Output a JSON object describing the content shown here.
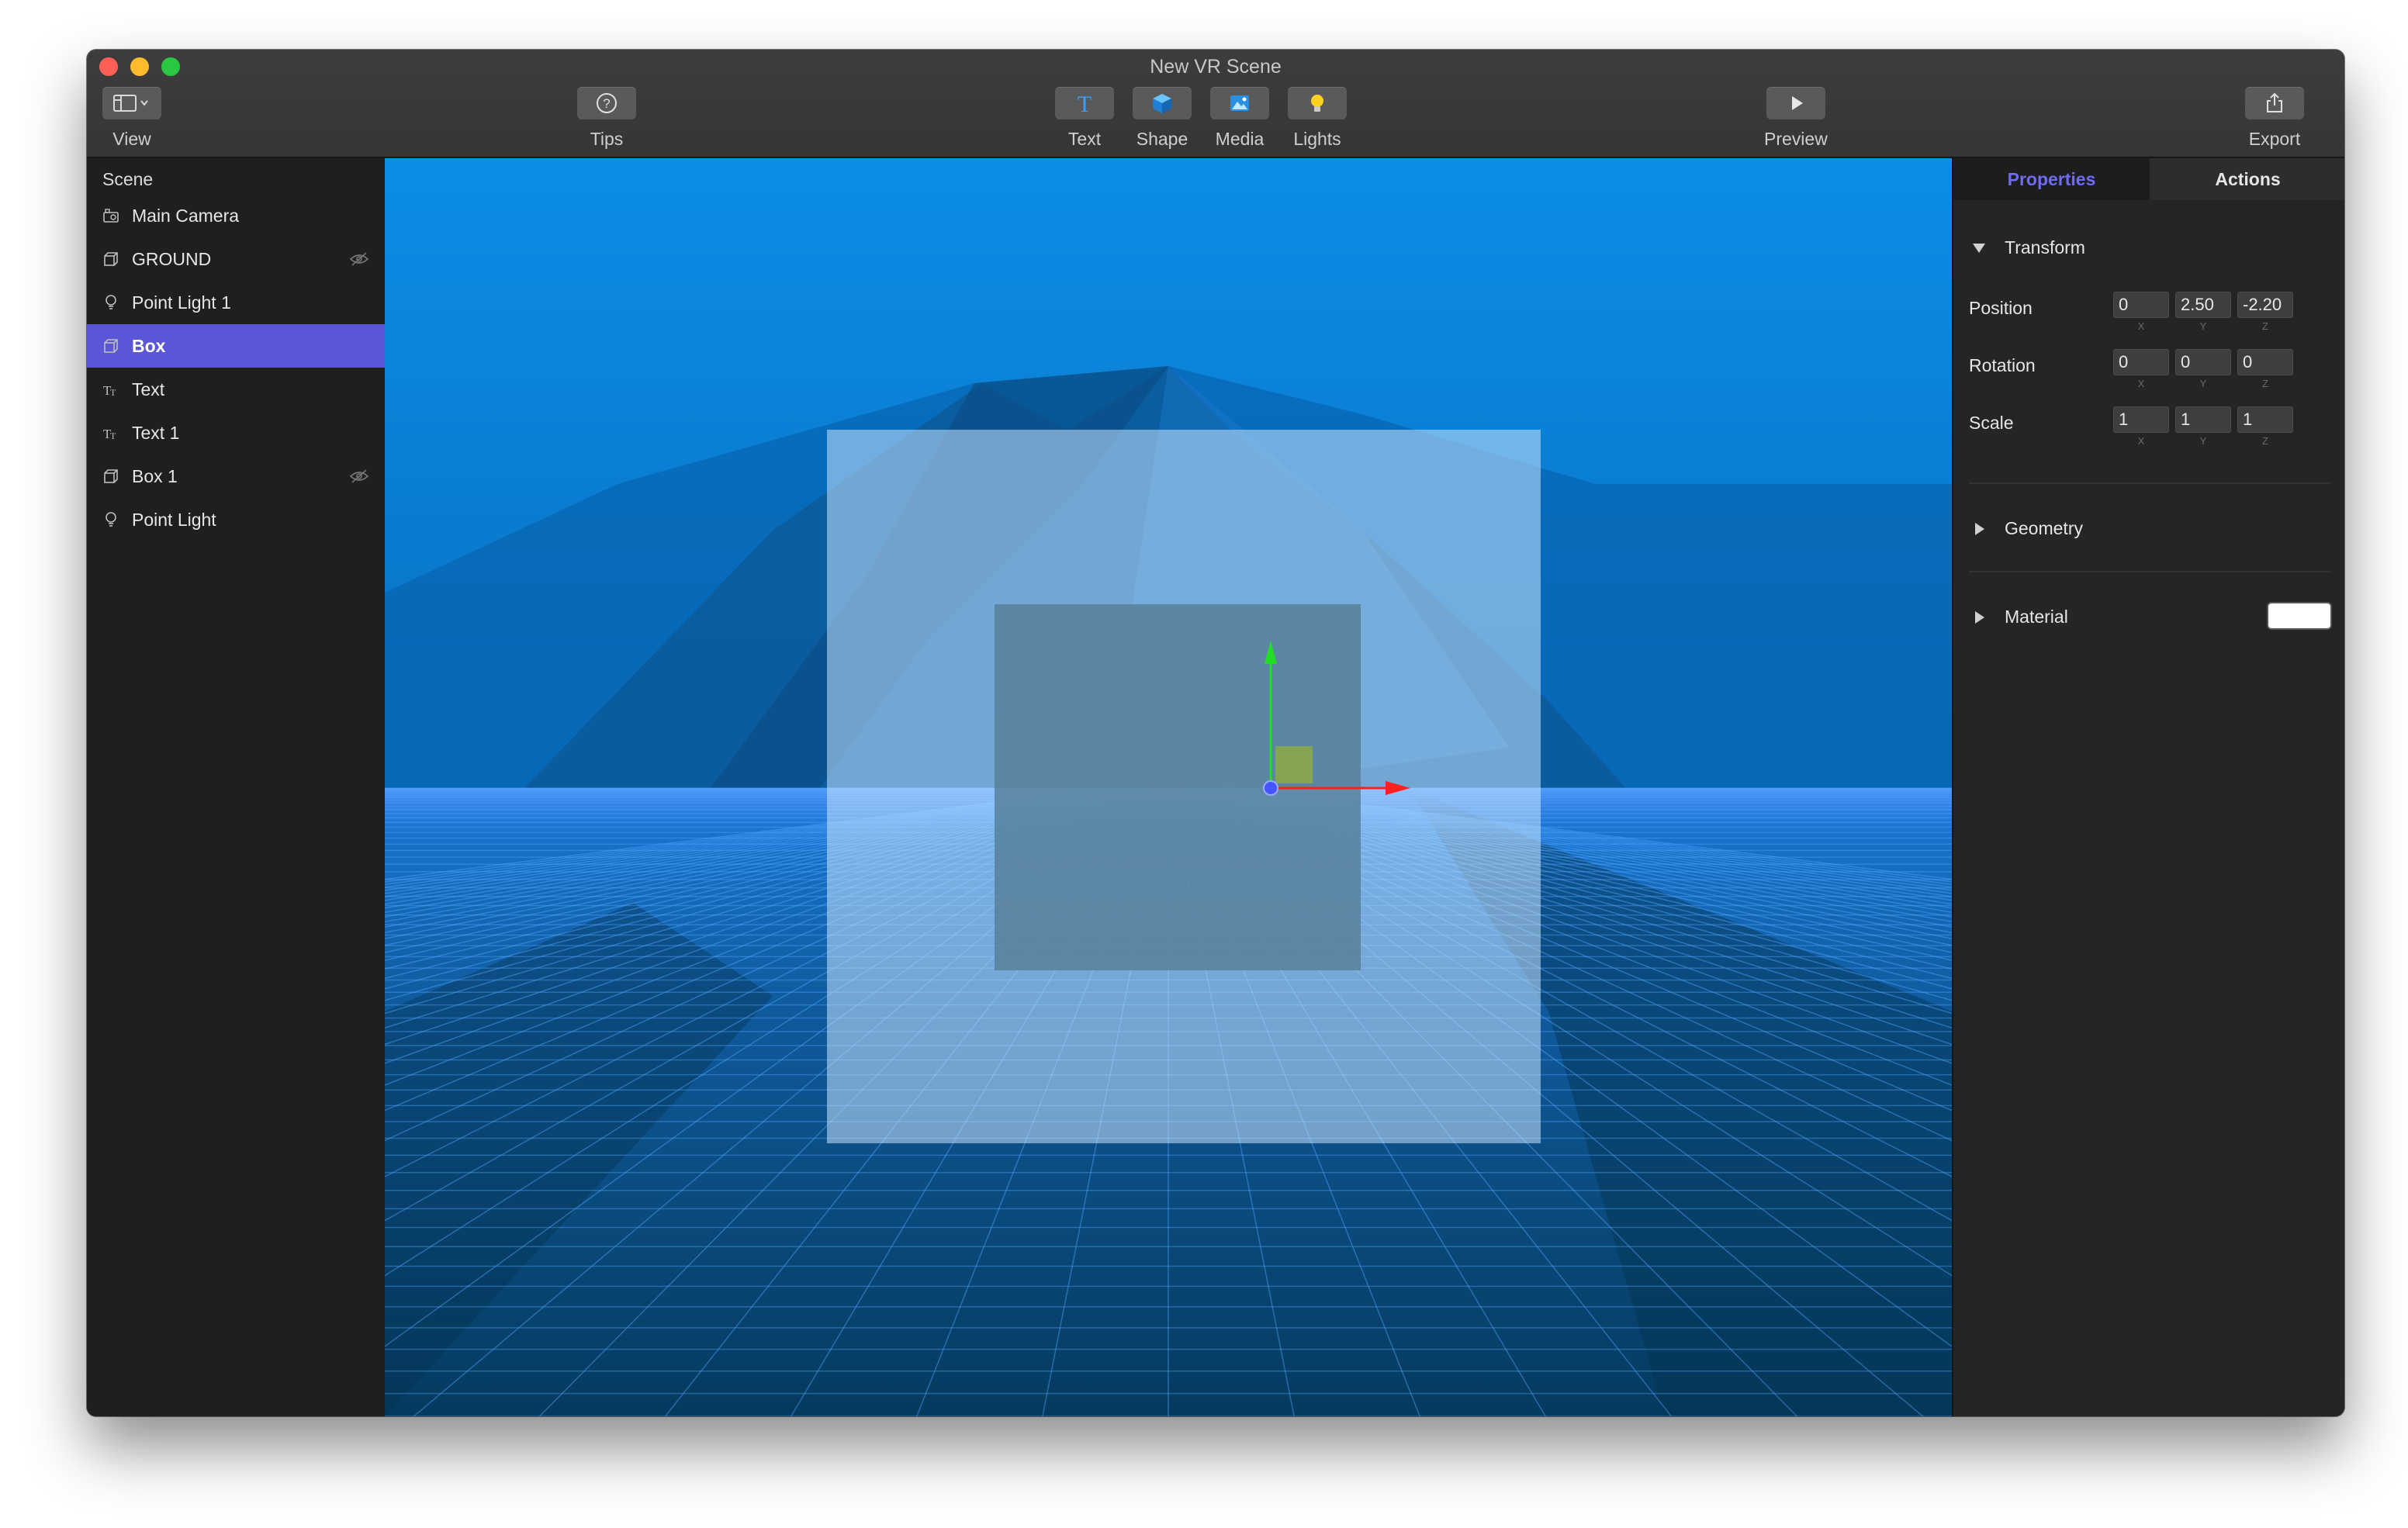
{
  "window": {
    "title": "New VR Scene"
  },
  "toolbar": {
    "view_label": "View",
    "tips_label": "Tips",
    "text_label": "Text",
    "shape_label": "Shape",
    "media_label": "Media",
    "lights_label": "Lights",
    "preview_label": "Preview",
    "export_label": "Export"
  },
  "sidebar": {
    "header": "Scene",
    "items": [
      {
        "label": "Main Camera",
        "icon": "camera-icon",
        "hidden": false,
        "selected": false
      },
      {
        "label": "GROUND",
        "icon": "cube-icon",
        "hidden": true,
        "selected": false
      },
      {
        "label": "Point Light 1",
        "icon": "bulb-icon",
        "hidden": false,
        "selected": false
      },
      {
        "label": "Box",
        "icon": "cube-icon",
        "hidden": false,
        "selected": true
      },
      {
        "label": "Text",
        "icon": "text-icon",
        "hidden": false,
        "selected": false
      },
      {
        "label": "Text 1",
        "icon": "text-icon",
        "hidden": false,
        "selected": false
      },
      {
        "label": "Box 1",
        "icon": "cube-icon",
        "hidden": true,
        "selected": false
      },
      {
        "label": "Point Light",
        "icon": "bulb-icon",
        "hidden": false,
        "selected": false
      }
    ]
  },
  "panel": {
    "tabs": {
      "properties": "Properties",
      "actions": "Actions"
    },
    "transform": {
      "title": "Transform",
      "axes": {
        "x": "X",
        "y": "Y",
        "z": "Z"
      },
      "position": {
        "label": "Position",
        "x": "0",
        "y": "2.50",
        "z": "-2.20"
      },
      "rotation": {
        "label": "Rotation",
        "x": "0",
        "y": "0",
        "z": "0"
      },
      "scale": {
        "label": "Scale",
        "x": "1",
        "y": "1",
        "z": "1"
      }
    },
    "geometry": {
      "title": "Geometry"
    },
    "material": {
      "title": "Material",
      "color": "#ffffff"
    }
  },
  "colors": {
    "accent": "#6f6cf3",
    "selection": "#5b56d6",
    "sky": "#0a86d8",
    "gizmo_x": "#ff2020",
    "gizmo_y": "#22dd22",
    "gizmo_z": "#4455ff"
  }
}
